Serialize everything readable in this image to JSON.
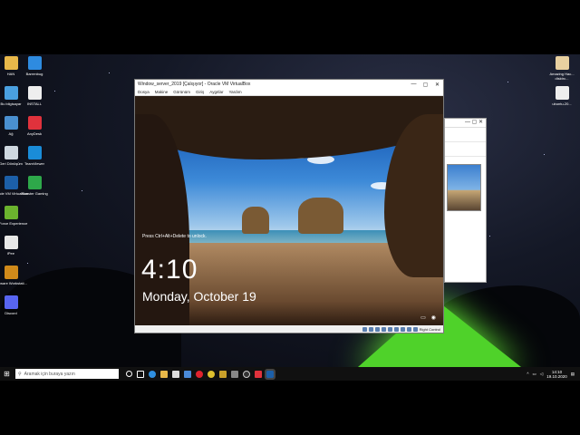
{
  "desktop": {
    "icons_left": [
      {
        "label": "HAN",
        "icon": "folder-icon",
        "color": "#e8b84a"
      },
      {
        "label": "Bu bilgisayar",
        "icon": "computer-icon",
        "color": "#4aa0e0"
      },
      {
        "label": "Ağ",
        "icon": "network-icon",
        "color": "#4a90d0"
      },
      {
        "label": "Geri Dönüşüm",
        "icon": "recycle-bin-icon",
        "color": "#cfd8e0"
      },
      {
        "label": "Oracle VM VirtualBox",
        "icon": "virtualbox-icon",
        "color": "#1c5fa8"
      },
      {
        "label": "GeForce Experience",
        "icon": "geforce-icon",
        "color": "#6bb32e"
      },
      {
        "label": "iPee",
        "icon": "file-icon",
        "color": "#e8e8e8"
      },
      {
        "label": "VMware Workstati...",
        "icon": "vmware-icon",
        "color": "#d08a1a"
      },
      {
        "label": "Discord",
        "icon": "discord-icon",
        "color": "#5865f2"
      }
    ],
    "icons_col2": [
      {
        "label": "Barrenbug",
        "icon": "app-icon",
        "color": "#2e8be0"
      },
      {
        "label": "INSTALL",
        "icon": "file-icon",
        "color": "#eeeeee"
      },
      {
        "label": "AnyDesk",
        "icon": "anydesk-icon",
        "color": "#e0323c"
      },
      {
        "label": "TeamViewer",
        "icon": "teamviewer-icon",
        "color": "#1a8cd8"
      },
      {
        "label": "Monster Gaming",
        "icon": "app-icon",
        "color": "#2ea84a"
      }
    ],
    "icons_right": [
      {
        "label": "Amazing Hac... disktrc...",
        "icon": "file-icon",
        "color": "#e8d0a0"
      },
      {
        "label": "ubuntu-20...",
        "icon": "file-icon",
        "color": "#eeeeee"
      }
    ]
  },
  "vm_window": {
    "title": "Window_server_2019 [Çalışıyor] - Oracle VM VirtualBox",
    "menu": [
      "Dosya",
      "Makine",
      "Görünüm",
      "Giriş",
      "Aygıtlar",
      "Yardım"
    ],
    "minimize_icon": "minimize-icon",
    "maximize_icon": "maximize-icon",
    "close_icon": "close-icon",
    "lock_screen": {
      "hint": "Press Ctrl+Alt+Delete to unlock.",
      "time": "4:10",
      "date": "Monday, October 19"
    },
    "status_host_key": "Right Control"
  },
  "taskbar": {
    "search_placeholder": "Aramak için buraya yazın",
    "clock_time": "14:10",
    "clock_date": "19.10.2020"
  },
  "colors": {
    "taskbar_bg": "#101010",
    "tent_glow": "#4fd22a",
    "lockscreen_text": "#ffffff"
  }
}
